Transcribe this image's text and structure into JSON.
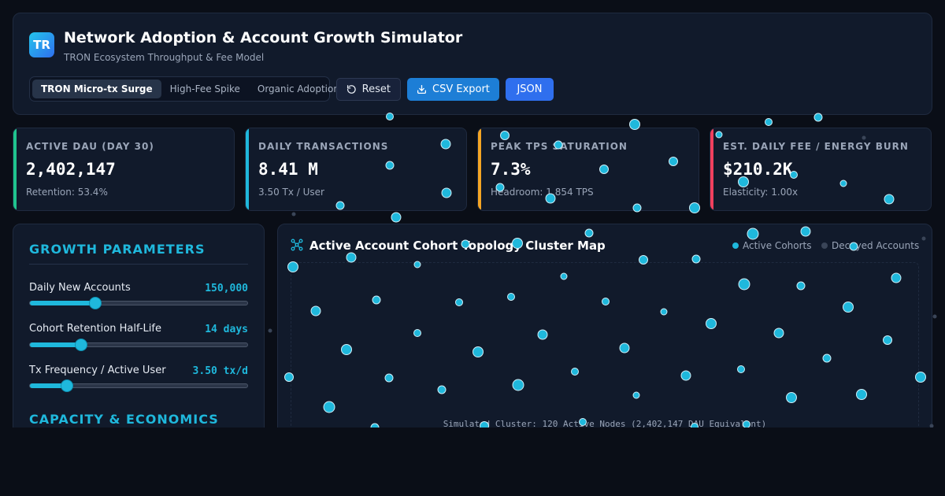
{
  "app": {
    "logo_text": "TR",
    "title": "Network Adoption & Account Growth Simulator",
    "subtitle": "TRON Ecosystem Throughput & Fee Model"
  },
  "presets": [
    {
      "label": "TRON Micro-tx Surge",
      "active": true
    },
    {
      "label": "High-Fee Spike",
      "active": false
    },
    {
      "label": "Organic Adoption",
      "active": false
    }
  ],
  "toolbar": {
    "reset_label": "Reset",
    "csv_label": "CSV Export",
    "json_label": "JSON"
  },
  "kpis": [
    {
      "label": "ACTIVE DAU (DAY 30)",
      "value": "2,402,147",
      "sub": "Retention: 53.4%",
      "color": "#1fc48e"
    },
    {
      "label": "DAILY TRANSACTIONS",
      "value": "8.41 M",
      "sub": "3.50 Tx / User",
      "color": "#1fb8dc"
    },
    {
      "label": "PEAK TPS SATURATION",
      "value": "7.3%",
      "sub": "Headroom: 1,854 TPS",
      "color": "#f5a524"
    },
    {
      "label": "EST. DAILY FEE / ENERGY BURN",
      "value": "$210.2K",
      "sub": "Elasticity: 1.00x",
      "color": "#f0405e"
    }
  ],
  "growth": {
    "title": "GROWTH PARAMETERS",
    "params": [
      {
        "label": "Daily New Accounts",
        "value": "150,000",
        "level": 0.297
      },
      {
        "label": "Cohort Retention Half-Life",
        "value": "14 days",
        "level": 0.235
      },
      {
        "label": "Tx Frequency / Active User",
        "value": "3.50 tx/d",
        "level": 0.17
      }
    ]
  },
  "capacity": {
    "title": "CAPACITY & ECONOMICS"
  },
  "cluster": {
    "title": "Active Account Cohort Topology Cluster Map",
    "legend_active": "Active Cohorts",
    "legend_decayed": "Decayed Accounts",
    "caption": "Simulated Cluster: 120 Active Nodes (2,402,147 DAU Equivalent)"
  },
  "colors": {
    "accent": "#1fb8dc",
    "brand": "#2f6fee",
    "decayed": "#3a4558"
  }
}
